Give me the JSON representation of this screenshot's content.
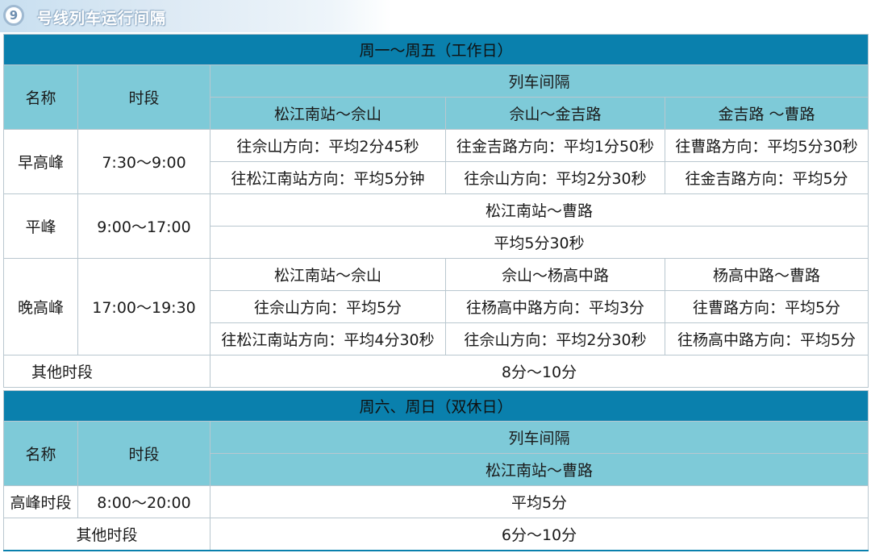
{
  "banner": {
    "number": "9",
    "title": "号线列车运行间隔"
  },
  "weekday": {
    "section_title": "周一～周五（工作日）",
    "col_name": "名称",
    "col_period": "时段",
    "col_interval": "列车间隔",
    "segments": [
      "松江南站～佘山",
      "佘山～金吉路",
      "金吉路 ～曹路"
    ],
    "morning": {
      "name": "早高峰",
      "time": "7:30～9:00",
      "row1": [
        "往佘山方向：平均2分45秒",
        "往金吉路方向：平均1分50秒",
        "往曹路方向：平均5分30秒"
      ],
      "row2": [
        "往松江南站方向：平均5分钟",
        "往佘山方向：平均2分30秒",
        "往金吉路方向：平均5分"
      ]
    },
    "offpeak": {
      "name": "平峰",
      "time": "9:00～17:00",
      "segment": "松江南站～曹路",
      "interval": "平均5分30秒"
    },
    "evening": {
      "name": "晚高峰",
      "time": "17:00～19:30",
      "segments": [
        "松江南站～佘山",
        "佘山～杨高中路",
        "杨高中路～曹路"
      ],
      "row1": [
        "往佘山方向：平均5分",
        "往杨高中路方向：平均3分",
        "往曹路方向：平均5分"
      ],
      "row2": [
        "往松江南站方向：平均4分30秒",
        "往佘山方向：平均2分30秒",
        "往杨高中路方向：平均5分"
      ]
    },
    "other": {
      "name": "其他时段",
      "interval": "8分～10分"
    }
  },
  "weekend": {
    "section_title": "周六、周日（双休日）",
    "col_name": "名称",
    "col_period": "时段",
    "col_interval": "列车间隔",
    "segment": "松江南站～曹路",
    "peak": {
      "name": "高峰时段",
      "time": "8:00～20:00",
      "interval": "平均5分"
    },
    "other": {
      "name": "其他时段",
      "interval": "6分～10分"
    }
  },
  "colors": {
    "section_bg": "#0a80ad",
    "header_bg": "#7ecad8",
    "border": "#b9c7cf"
  }
}
